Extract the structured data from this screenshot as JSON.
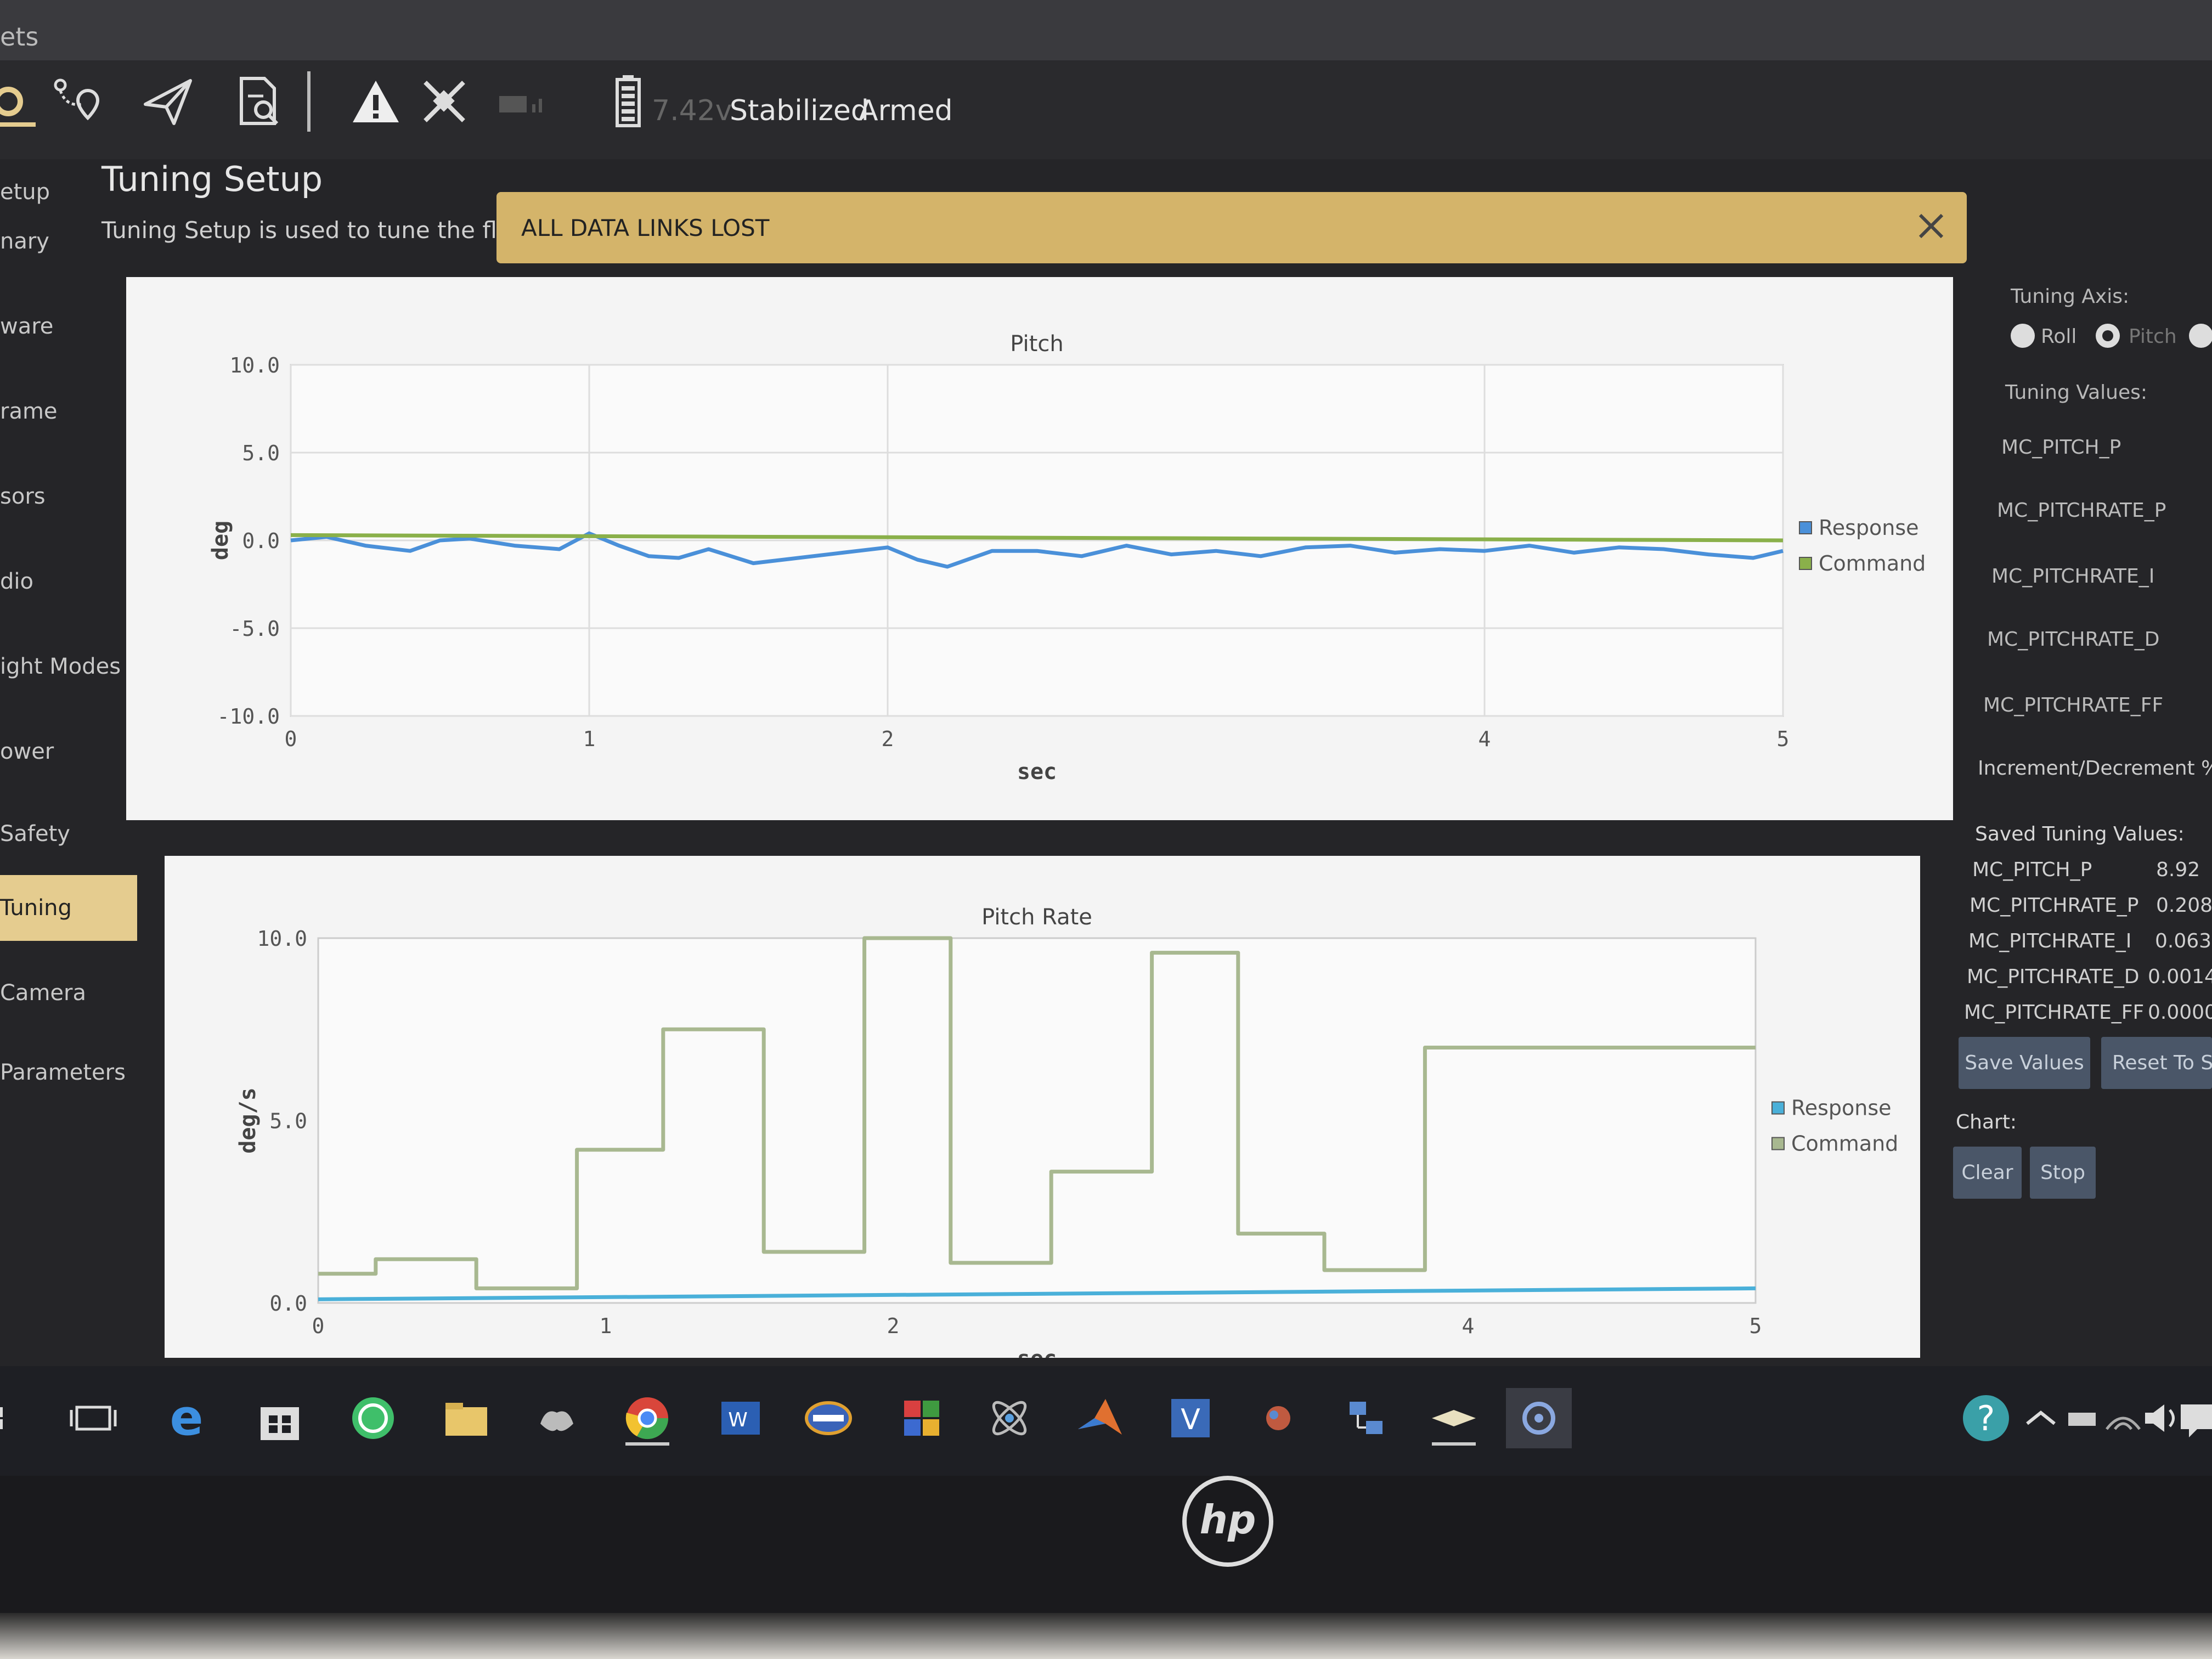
{
  "topstrip": {
    "text": "ets"
  },
  "toolbar": {
    "voltage": "7.42v",
    "flight_mode": "Stabilized",
    "arm_state": "Armed"
  },
  "sidebar": {
    "items": [
      {
        "label": "etup"
      },
      {
        "label": "nary"
      },
      {
        "label": "ware"
      },
      {
        "label": "rame"
      },
      {
        "label": "sors"
      },
      {
        "label": "dio"
      },
      {
        "label": "ight Modes"
      },
      {
        "label": "ower"
      },
      {
        "label": "Safety"
      },
      {
        "label": "Tuning"
      },
      {
        "label": "Camera"
      },
      {
        "label": "Parameters"
      }
    ],
    "active_index": 9
  },
  "page": {
    "title": "Tuning Setup",
    "subtitle": "Tuning Setup is used to tune the flight"
  },
  "banner": {
    "text": "ALL DATA LINKS LOST",
    "color": "#d4b46a"
  },
  "right_panel": {
    "tuning_axis_label": "Tuning Axis:",
    "axis_options": [
      {
        "label": "Roll",
        "selected": false
      },
      {
        "label": "Pitch",
        "selected": true
      }
    ],
    "tuning_values_label": "Tuning Values:",
    "params": [
      "MC_PITCH_P",
      "MC_PITCHRATE_P",
      "MC_PITCHRATE_I",
      "MC_PITCHRATE_D",
      "MC_PITCHRATE_FF"
    ],
    "increment_label": "Increment/Decrement %",
    "saved_label": "Saved Tuning Values:",
    "saved": [
      {
        "name": "MC_PITCH_P",
        "value": "8.92"
      },
      {
        "name": "MC_PITCHRATE_P",
        "value": "0.208"
      },
      {
        "name": "MC_PITCHRATE_I",
        "value": "0.063"
      },
      {
        "name": "MC_PITCHRATE_D",
        "value": "0.0014"
      },
      {
        "name": "MC_PITCHRATE_FF",
        "value": "0.0000"
      }
    ],
    "save_button": "Save Values",
    "reset_button": "Reset To Sa",
    "chart_label": "Chart:",
    "clear_button": "Clear",
    "stop_button": "Stop"
  },
  "chart_data": [
    {
      "type": "line",
      "title": "Pitch",
      "xlabel": "sec",
      "ylabel": "deg",
      "xlim": [
        0,
        5
      ],
      "ylim": [
        -10,
        10
      ],
      "x_ticks": [
        "0",
        "1",
        "2",
        "4",
        "5"
      ],
      "y_ticks": [
        "10.0",
        "5.0",
        "0.0",
        "-5.0",
        "-10.0"
      ],
      "grid": true,
      "legend": "right",
      "series": [
        {
          "name": "Response",
          "color": "#4a90d9",
          "x": [
            0,
            0.12,
            0.25,
            0.4,
            0.5,
            0.6,
            0.75,
            0.9,
            1.0,
            1.1,
            1.2,
            1.3,
            1.4,
            1.55,
            1.7,
            1.85,
            2.0,
            2.1,
            2.2,
            2.35,
            2.5,
            2.65,
            2.8,
            2.95,
            3.1,
            3.25,
            3.4,
            3.55,
            3.7,
            3.85,
            4.0,
            4.15,
            4.3,
            4.45,
            4.6,
            4.75,
            4.9,
            5.0
          ],
          "y": [
            0.0,
            0.2,
            -0.3,
            -0.6,
            0.0,
            0.1,
            -0.3,
            -0.5,
            0.4,
            -0.3,
            -0.9,
            -1.0,
            -0.5,
            -1.3,
            -1.0,
            -0.7,
            -0.4,
            -1.1,
            -1.5,
            -0.6,
            -0.6,
            -0.9,
            -0.3,
            -0.8,
            -0.6,
            -0.9,
            -0.4,
            -0.3,
            -0.7,
            -0.5,
            -0.6,
            -0.3,
            -0.7,
            -0.4,
            -0.5,
            -0.8,
            -1.0,
            -0.6
          ]
        },
        {
          "name": "Command",
          "color": "#8ab04a",
          "x": [
            0,
            5
          ],
          "y": [
            0.3,
            0.0
          ]
        }
      ]
    },
    {
      "type": "line",
      "title": "Pitch Rate",
      "xlabel": "sec",
      "ylabel": "deg/s",
      "xlim": [
        0,
        5
      ],
      "ylim": [
        0,
        10
      ],
      "x_ticks": [
        "0",
        "1",
        "2",
        "4",
        "5"
      ],
      "y_ticks": [
        "10.0",
        "5.0",
        "0.0"
      ],
      "grid": false,
      "legend": "right",
      "series": [
        {
          "name": "Response",
          "color": "#4ab0d9",
          "x": [
            0,
            5
          ],
          "y": [
            0.1,
            0.4
          ]
        },
        {
          "name": "Command",
          "color": "#a8b890",
          "x": [
            0.0,
            0.2,
            0.2,
            0.55,
            0.55,
            0.9,
            0.9,
            1.2,
            1.2,
            1.55,
            1.55,
            1.9,
            1.9,
            2.2,
            2.2,
            2.55,
            2.55,
            2.9,
            2.9,
            3.2,
            3.2,
            3.5,
            3.5,
            3.85,
            3.85,
            4.15,
            4.15,
            4.5,
            4.5,
            4.8,
            4.8,
            5.0
          ],
          "y": [
            0.8,
            0.8,
            1.2,
            1.2,
            0.4,
            0.4,
            4.2,
            4.2,
            7.5,
            7.5,
            1.4,
            1.4,
            10.0,
            10.0,
            1.1,
            1.1,
            3.6,
            3.6,
            9.6,
            9.6,
            1.9,
            1.9,
            0.9,
            0.9,
            7.0,
            7.0,
            7.0,
            7.0,
            7.0,
            7.0,
            7.0,
            7.0
          ]
        }
      ]
    }
  ]
}
